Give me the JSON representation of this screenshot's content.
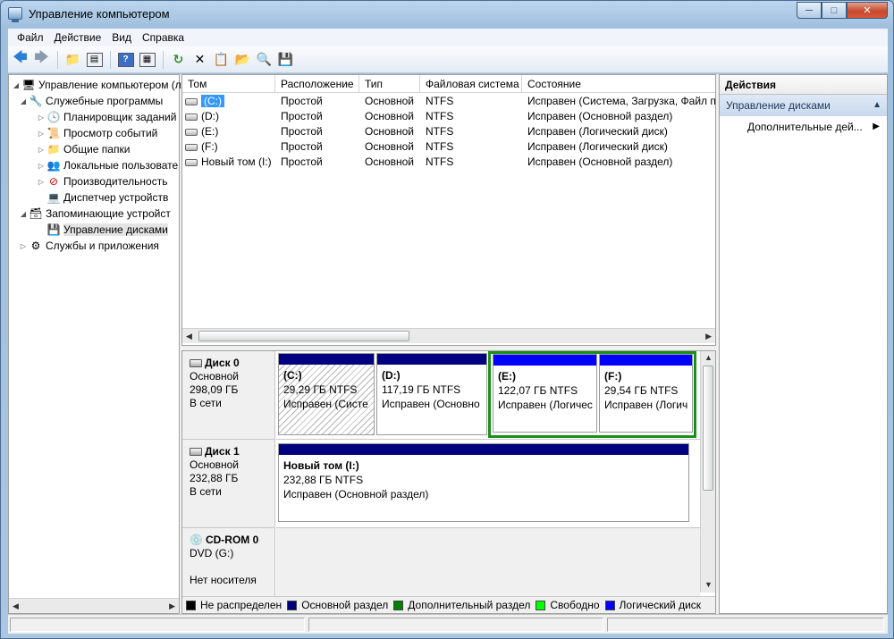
{
  "window": {
    "title": "Управление компьютером"
  },
  "menu": [
    "Файл",
    "Действие",
    "Вид",
    "Справка"
  ],
  "toolbar": {
    "icons": [
      "back-icon",
      "forward-icon",
      "up-folder-icon",
      "show-hide-tree-icon",
      "help-icon",
      "show-action-pane-icon",
      "refresh-icon",
      "delete-icon",
      "properties-icon",
      "open-icon",
      "find-icon",
      "rescan-icon"
    ]
  },
  "tree": {
    "root": "Управление компьютером (л",
    "system_tools": "Служебные программы",
    "task_scheduler": "Планировщик заданий",
    "event_viewer": "Просмотр событий",
    "shared_folders": "Общие папки",
    "local_users": "Локальные пользовате",
    "performance": "Производительность",
    "device_manager": "Диспетчер устройств",
    "storage": "Запоминающие устройст",
    "disk_management": "Управление дисками",
    "services": "Службы и приложения"
  },
  "volumes": {
    "columns": [
      "Том",
      "Расположение",
      "Тип",
      "Файловая система",
      "Состояние"
    ],
    "rows": [
      {
        "volume": "(C:)",
        "layout": "Простой",
        "type": "Основной",
        "fs": "NTFS",
        "status": "Исправен (Система, Загрузка, Файл п"
      },
      {
        "volume": "(D:)",
        "layout": "Простой",
        "type": "Основной",
        "fs": "NTFS",
        "status": "Исправен (Основной раздел)"
      },
      {
        "volume": "(E:)",
        "layout": "Простой",
        "type": "Основной",
        "fs": "NTFS",
        "status": "Исправен (Логический диск)"
      },
      {
        "volume": "(F:)",
        "layout": "Простой",
        "type": "Основной",
        "fs": "NTFS",
        "status": "Исправен (Логический диск)"
      },
      {
        "volume": "Новый том (I:)",
        "layout": "Простой",
        "type": "Основной",
        "fs": "NTFS",
        "status": "Исправен (Основной раздел)"
      }
    ]
  },
  "disks": {
    "disk0": {
      "name": "Диск 0",
      "kind": "Основной",
      "size": "298,09 ГБ",
      "state": "В сети",
      "partitions": [
        {
          "title": "(C:)",
          "size": "29,29 ГБ NTFS",
          "status": "Исправен (Систе"
        },
        {
          "title": "(D:)",
          "size": "117,19 ГБ NTFS",
          "status": "Исправен (Основно"
        },
        {
          "title": "(E:)",
          "size": "122,07 ГБ NTFS",
          "status": "Исправен (Логичес"
        },
        {
          "title": "(F:)",
          "size": "29,54 ГБ NTFS",
          "status": "Исправен (Логич"
        }
      ]
    },
    "disk1": {
      "name": "Диск 1",
      "kind": "Основной",
      "size": "232,88 ГБ",
      "state": "В сети",
      "partitions": [
        {
          "title": "Новый том  (I:)",
          "size": "232,88 ГБ NTFS",
          "status": "Исправен (Основной раздел)"
        }
      ]
    },
    "cdrom0": {
      "name": "CD-ROM 0",
      "kind": "DVD (G:)",
      "state": "Нет носителя"
    }
  },
  "legend": [
    {
      "label": "Не распределен",
      "color": "#000000"
    },
    {
      "label": "Основной раздел",
      "color": "#00007f"
    },
    {
      "label": "Дополнительный раздел",
      "color": "#008000"
    },
    {
      "label": "Свободно",
      "color": "#00ff00"
    },
    {
      "label": "Логический диск",
      "color": "#0000ff"
    }
  ],
  "actions": {
    "title": "Действия",
    "section": "Управление дисками",
    "more": "Дополнительные дей..."
  }
}
